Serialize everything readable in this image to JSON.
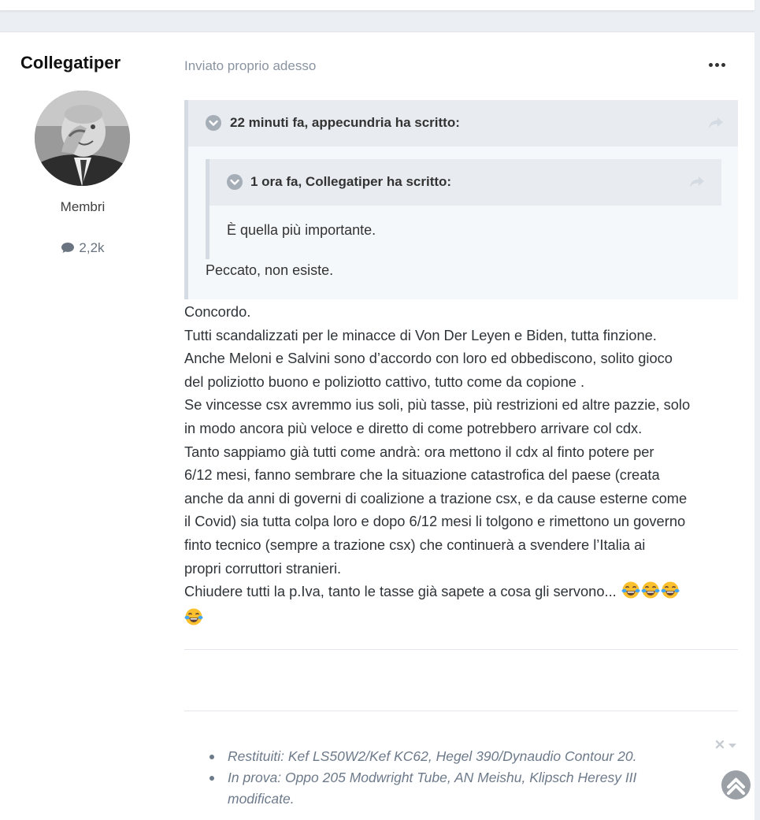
{
  "author": {
    "name": "Collegatiper",
    "group": "Membri",
    "posts": "2,2k"
  },
  "post": {
    "date": "Inviato proprio adesso",
    "quote": {
      "header": "22 minuti fa, appecundria ha scritto:",
      "nested_quote": {
        "header": "1 ora fa, Collegatiper ha scritto:",
        "text": "È quella più importante."
      },
      "reply": "Peccato, non esiste."
    },
    "lines": [
      "Concordo.",
      "Tutti scandalizzati per le minacce di Von Der Leyen e Biden, tutta finzione.",
      "Anche Meloni e Salvini sono d’accordo con loro ed obbediscono, solito gioco",
      "del poliziotto buono e poliziotto cattivo, tutto come da copione .",
      "Se vincesse csx avremmo ius soli, più tasse, più restrizioni ed altre pazzie, solo",
      "in modo ancora più veloce e diretto di come potrebbero arrivare col cdx.",
      "Tanto sappiamo già tutti come andrà: ora mettono il cdx al finto potere per",
      "6/12 mesi, fanno sembrare che la situazione catastrofica del paese (creata",
      "anche da anni di governi di coalizione a trazione csx, e da cause esterne come",
      "il Covid) sia tutta colpa loro e dopo 6/12 mesi li tolgono e rimettono un governo",
      "finto tecnico (sempre a trazione csx) che continuerà a  svendere l’Italia ai",
      "propri corruttori stranieri."
    ],
    "last_line": "Chiudere tutti la p.Iva, tanto le tasse già sapete a cosa gli servono..."
  },
  "signature": {
    "items": [
      "Restituiti: Kef LS50W2/Kef KC62, Hegel 390/Dynaudio Contour 20.",
      "In prova: Oppo 205 Modwright Tube, AN Meishu, Klipsch Heresy III",
      "modificate."
    ]
  },
  "icons": {
    "more": "ellipsis-icon",
    "quote_toggle": "chevron-down-circle-icon",
    "share": "share-arrow-icon",
    "posts": "speech-bubble-icon",
    "emoji": "tears-of-joy-emoji",
    "signature_close": "close-icon",
    "scroll_top": "chevron-up-icon"
  },
  "colors": {
    "page_bg": "#ebeef2",
    "card_bg": "#ffffff",
    "quote_bg": "#f5f8fb",
    "quote_header_bg": "#e8ecf1",
    "meta_text": "#8a94a0",
    "signature_text": "#6d7a8a"
  }
}
